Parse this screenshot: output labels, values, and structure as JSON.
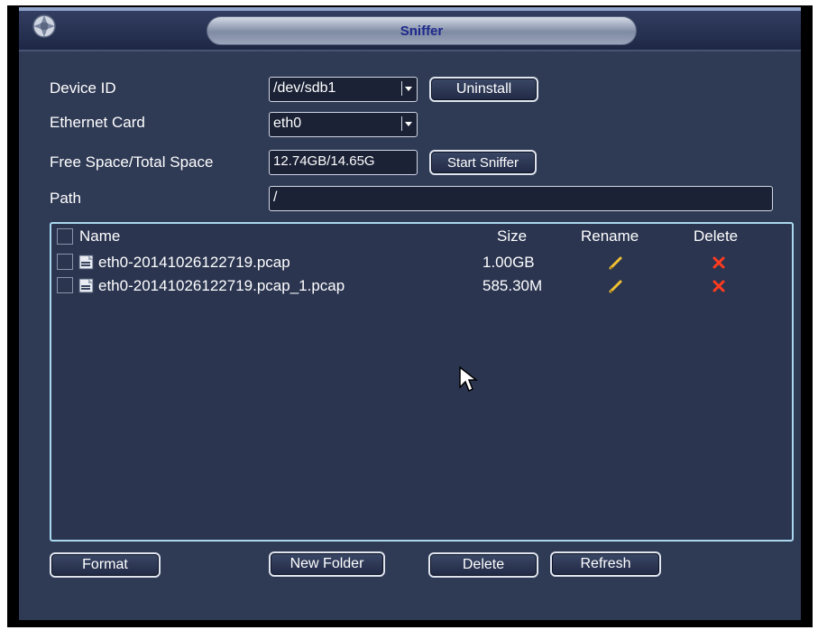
{
  "window": {
    "title": "Sniffer"
  },
  "form": {
    "device_id_label": "Device ID",
    "device_id_value": "/dev/sdb1",
    "ethernet_label": "Ethernet Card",
    "ethernet_value": "eth0",
    "space_label": "Free Space/Total Space",
    "space_value": "12.74GB/14.65G",
    "path_label": "Path",
    "path_value": "/"
  },
  "buttons": {
    "uninstall": "Uninstall",
    "start_sniffer": "Start Sniffer",
    "format": "Format",
    "new_folder": "New Folder",
    "delete": "Delete",
    "refresh": "Refresh"
  },
  "table": {
    "headers": {
      "name": "Name",
      "size": "Size",
      "rename": "Rename",
      "delete": "Delete"
    },
    "rows": [
      {
        "name": "eth0-20141026122719.pcap",
        "size": "1.00GB"
      },
      {
        "name": "eth0-20141026122719.pcap_1.pcap",
        "size": "585.30M"
      }
    ]
  },
  "colors": {
    "window_bg": "#2f3a55",
    "title_text": "#1d2a8c",
    "list_border": "#a9d8ee",
    "rename_icon": "#f2c233",
    "delete_icon": "#ff3b1f"
  },
  "icons": {
    "app": "camera-wheel-icon",
    "file": "file-icon",
    "rename": "pencil-icon",
    "delete": "x-icon",
    "cursor": "mouse-pointer-icon"
  }
}
